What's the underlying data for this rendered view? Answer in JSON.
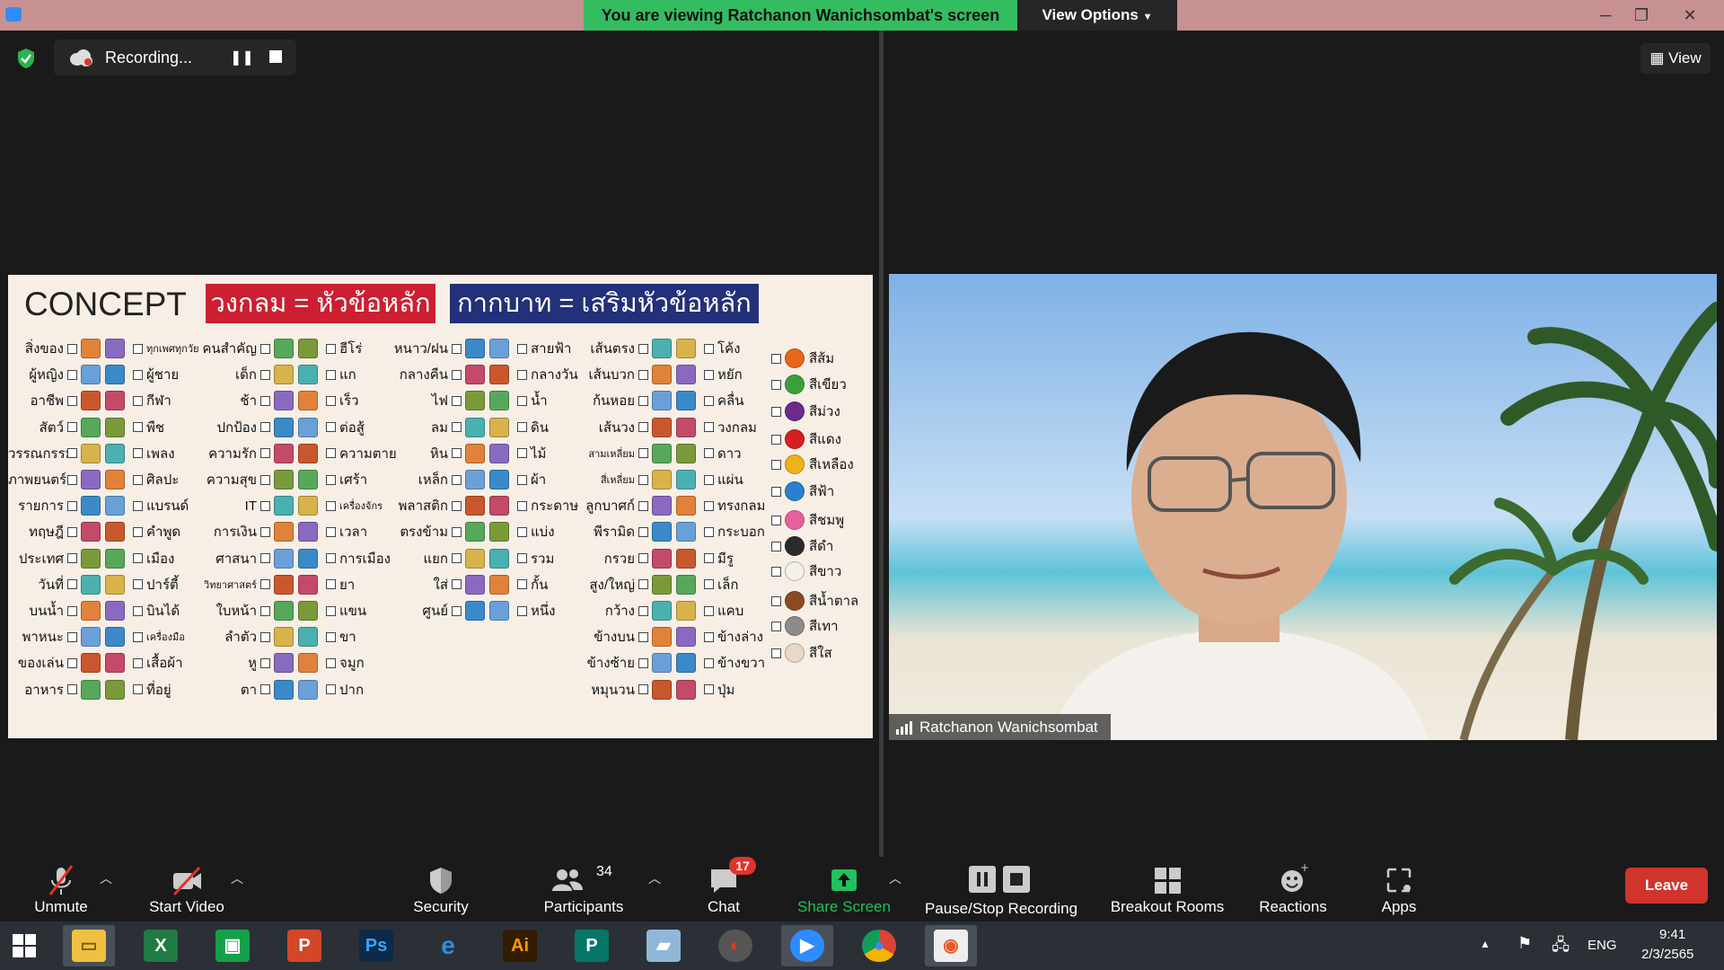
{
  "titlebar": {
    "viewing_text": "You are viewing Ratchanon Wanichsombat's screen",
    "view_options": "View Options"
  },
  "recording": {
    "status": "Recording..."
  },
  "view_button": "View",
  "slide": {
    "concept": "CONCEPT",
    "red_banner": "วงกลม = หัวข้อหลัก",
    "blue_banner": "กากบาท = เสริมหัวข้อหลัก",
    "col1": {
      "left": [
        "สิ่งของ",
        "ผู้หญิง",
        "อาชีพ",
        "สัตว์",
        "วรรณกรรม",
        "ภาพยนตร์",
        "รายการ",
        "ทฤษฎี",
        "ประเทศ",
        "วันที่",
        "บนน้ำ",
        "พาหนะ",
        "ของเล่น",
        "อาหาร"
      ],
      "right": [
        "ทุกเพศทุกวัย",
        "ผู้ชาย",
        "กีฬา",
        "พืช",
        "เพลง",
        "ศิลปะ",
        "แบรนด์",
        "คำพูด",
        "เมือง",
        "ปาร์ตี้",
        "บินได้",
        "เครื่องมือ",
        "เสื้อผ้า",
        "ที่อยู่"
      ]
    },
    "col2": {
      "left": [
        "คนสำคัญ",
        "เด็ก",
        "ช้า",
        "ปกป้อง",
        "ความรัก",
        "ความสุข",
        "IT",
        "การเงิน",
        "ศาสนา",
        "วิทยาศาสตร์",
        "ใบหน้า",
        "ลำตัว",
        "หู",
        "ตา"
      ],
      "right": [
        "ฮีโร่",
        "แก",
        "เร็ว",
        "ต่อสู้",
        "ความตาย",
        "เศร้า",
        "เครื่องจักร",
        "เวลา",
        "การเมือง",
        "ยา",
        "แขน",
        "ขา",
        "จมูก",
        "ปาก"
      ]
    },
    "col3": {
      "left": [
        "หนาว/ฝน",
        "กลางคืน",
        "ไฟ",
        "ลม",
        "หิน",
        "เหล็ก",
        "พลาสติก",
        "ตรงข้าม",
        "แยก",
        "ใส่",
        "ศูนย์"
      ],
      "right": [
        "สายฟ้า",
        "กลางวัน",
        "น้ำ",
        "ดิน",
        "ไม้",
        "ผ้า",
        "กระดาษ",
        "แบ่ง",
        "รวม",
        "กั้น",
        "หนึ่ง"
      ]
    },
    "col4": {
      "left": [
        "เส้นตรง",
        "เส้นบวก",
        "ก้นหอย",
        "เส้นวง",
        "สามเหลี่ยม",
        "สี่เหลี่ยม",
        "ลูกบาศก์",
        "พีรามิด",
        "กรวย",
        "สูง/ใหญ่",
        "กว้าง",
        "ข้างบน",
        "ข้างซ้าย",
        "หมุนวน"
      ],
      "right": [
        "โค้ง",
        "หยัก",
        "คลื่น",
        "วงกลม",
        "ดาว",
        "แผ่น",
        "ทรงกลม",
        "กระบอก",
        "มีรู",
        "เล็ก",
        "แคบ",
        "ข้างล่าง",
        "ข้างขวา",
        "ปุ่ม"
      ]
    },
    "colors": [
      "สีส้ม",
      "สีเขียว",
      "สีม่วง",
      "สีแดง",
      "สีเหลือง",
      "สีฟ้า",
      "สีชมพู",
      "สีดำ",
      "สีขาว",
      "สีน้ำตาล",
      "สีเทา",
      "สีใส"
    ],
    "color_swatches": [
      "#e8651c",
      "#3aa13a",
      "#6b2a8c",
      "#d42020",
      "#f0b21a",
      "#2a7fcf",
      "#e8609a",
      "#2a2a2a",
      "#f4f0ea",
      "#8a4b22",
      "#8c8c8c",
      "#e9d8c7"
    ]
  },
  "video": {
    "name": "Ratchanon Wanichsombat"
  },
  "toolbar": {
    "unmute": "Unmute",
    "start_video": "Start Video",
    "security": "Security",
    "participants": "Participants",
    "participants_count": "34",
    "chat": "Chat",
    "chat_badge": "17",
    "share_screen": "Share Screen",
    "pause_stop": "Pause/Stop Recording",
    "breakout": "Breakout Rooms",
    "reactions": "Reactions",
    "apps": "Apps",
    "leave": "Leave"
  },
  "taskbar": {
    "lang": "ENG",
    "time": "9:41",
    "date": "2/3/2565",
    "apps": [
      "file-explorer",
      "excel",
      "store",
      "powerpoint",
      "photoshop",
      "internet-explorer",
      "illustrator",
      "publisher",
      "writer",
      "photoscape",
      "zoom",
      "chrome",
      "image-viewer"
    ]
  },
  "colors": {
    "green_banner": "#33bd60",
    "leave": "#d0342c",
    "share": "#21c15b",
    "red_banner": "#cc1f32",
    "blue_banner": "#23307a"
  }
}
